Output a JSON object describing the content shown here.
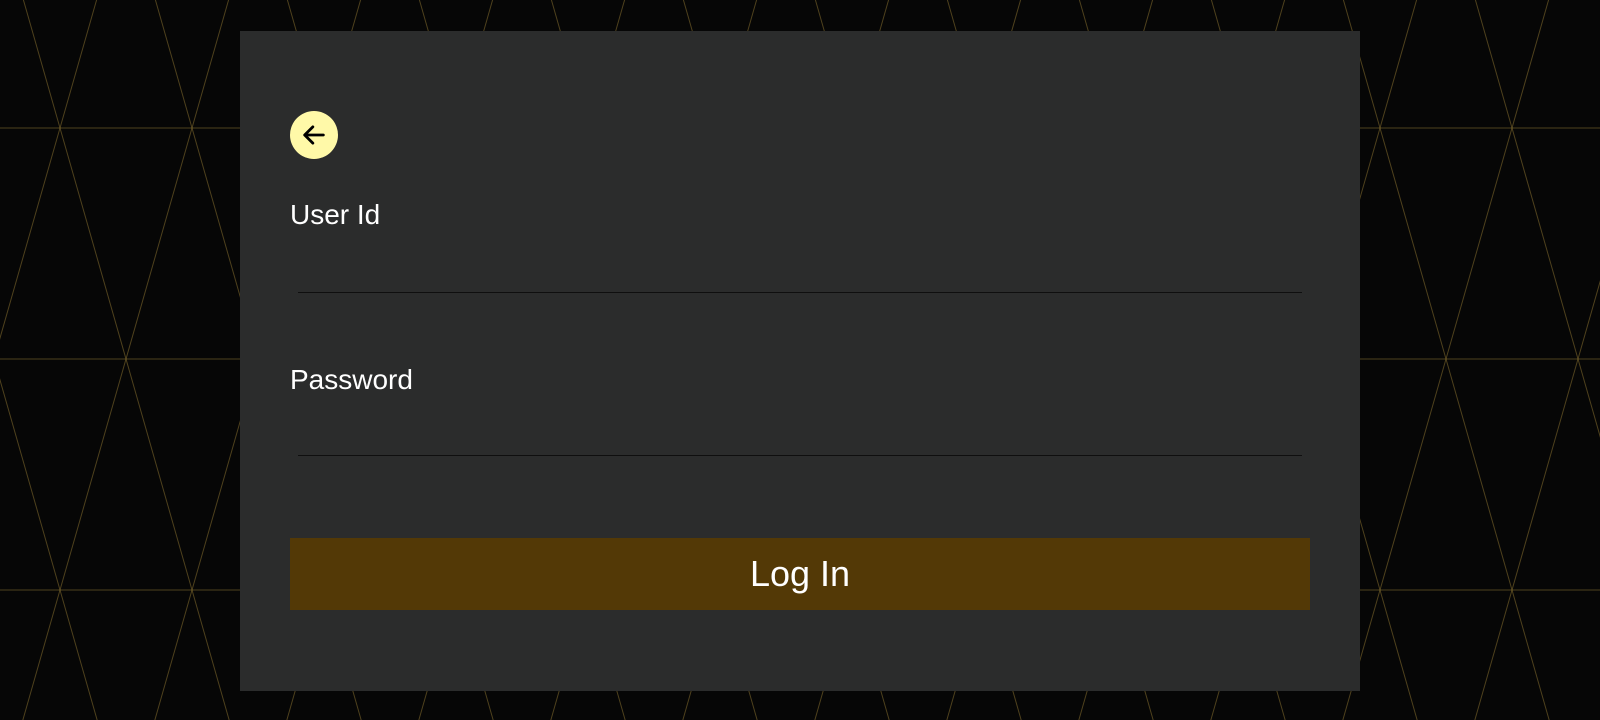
{
  "colors": {
    "page_background": "#060606",
    "pattern_line": "#8a7232",
    "card_background": "#2b2c2c",
    "back_button": "#fff9a8",
    "login_button": "#533906",
    "text": "#ffffff"
  },
  "back_button": {
    "icon": "arrow-left-icon"
  },
  "form": {
    "user_id_label": "User Id",
    "user_id_value": "",
    "password_label": "Password",
    "password_value": "",
    "login_label": "Log In"
  }
}
